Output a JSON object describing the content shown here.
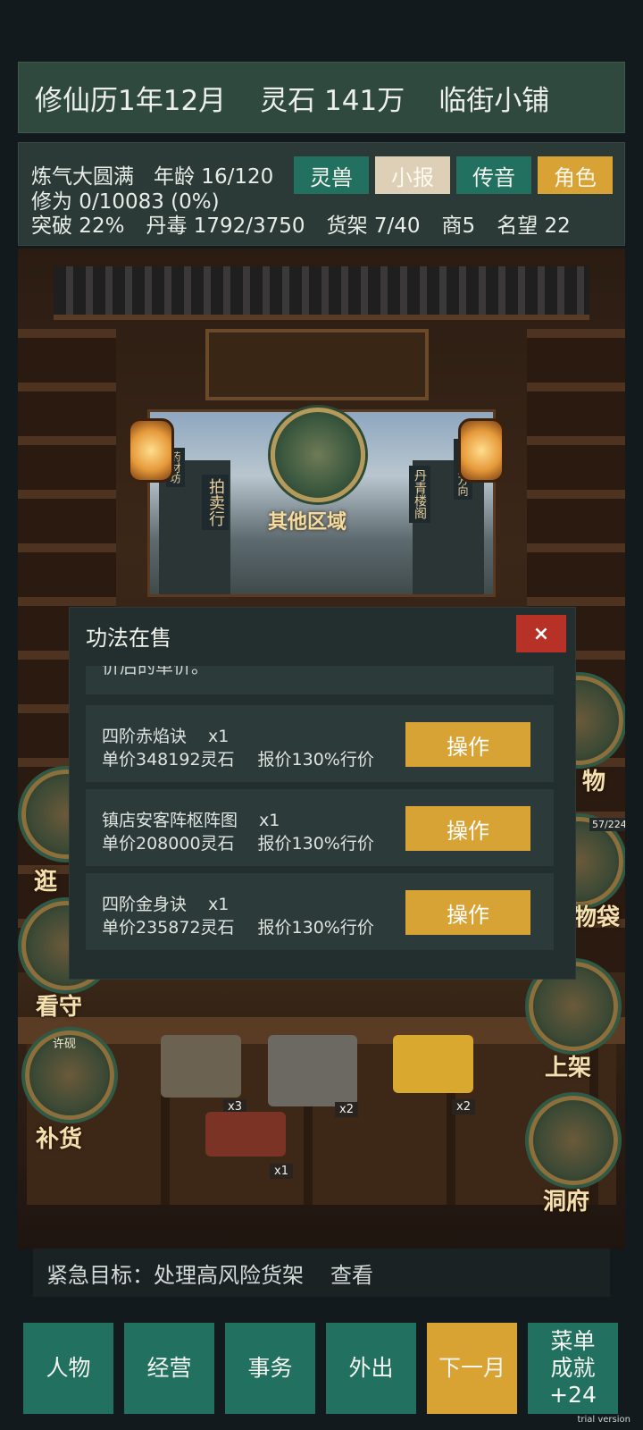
{
  "header": {
    "calendar": "修仙历1年12月",
    "spirit_stones": "灵石 141万",
    "shop_name": "临街小铺"
  },
  "stats": {
    "realm": "炼气大圆满",
    "age": "年龄 16/120",
    "cultivation": "修为 0/10083 (0%)",
    "breakthrough": "突破 22%",
    "pill_poison": "丹毒 1792/3750",
    "shelves": "货架 7/40",
    "merchant": "商5",
    "reputation": "名望 22"
  },
  "quick_tabs": [
    {
      "label": "灵兽",
      "color": "#22705f"
    },
    {
      "label": "小报",
      "color": "#ddd0b6"
    },
    {
      "label": "传音",
      "color": "#22705f"
    },
    {
      "label": "角色",
      "color": "#d8a234"
    }
  ],
  "scene": {
    "region_button": "其他区域",
    "street_signs": [
      "拍卖行",
      "药材坊",
      "城主府方向",
      "丹青楼阁"
    ],
    "left_buttons": [
      {
        "label": "逛",
        "icon": "scroll-shelf-icon"
      },
      {
        "label": "看守",
        "icon": "guard-icon"
      },
      {
        "label": "补货",
        "icon": "restock-basket-icon",
        "tag": "许砚"
      }
    ],
    "right_buttons": [
      {
        "label": "物",
        "icon": "goods-icon"
      },
      {
        "label": "物袋",
        "icon": "storage-bag-icon",
        "count": "57/224"
      },
      {
        "label": "上架",
        "icon": "shelf-icon"
      },
      {
        "label": "洞府",
        "icon": "cave-icon"
      }
    ],
    "counter_items": [
      {
        "name": "books-icon",
        "qty": "x3"
      },
      {
        "name": "map-icon",
        "qty": "x2"
      },
      {
        "name": "talisman-icon",
        "qty": "x2"
      },
      {
        "name": "potion-chest-icon",
        "qty": "x1"
      }
    ]
  },
  "modal": {
    "title": "功法在售",
    "close": "×",
    "note": "价后的单价。",
    "listings": [
      {
        "name": "四阶赤焰诀",
        "qty": "x1",
        "price": "单价348192灵石",
        "pct": "报价130%行价",
        "action": "操作"
      },
      {
        "name": "镇店安客阵枢阵图",
        "qty": "x1",
        "price": "单价208000灵石",
        "pct": "报价130%行价",
        "action": "操作"
      },
      {
        "name": "四阶金身诀",
        "qty": "x1",
        "price": "单价235872灵石",
        "pct": "报价130%行价",
        "action": "操作"
      }
    ]
  },
  "goal": {
    "text": "紧急目标：处理高风险货架",
    "link": "查看"
  },
  "bottom_nav": {
    "character": "人物",
    "operate": "经营",
    "affairs": "事务",
    "outing": "外出",
    "next_month": "下一月",
    "menu": "菜单",
    "achievement": "成就+24"
  },
  "watermark": "trial version"
}
